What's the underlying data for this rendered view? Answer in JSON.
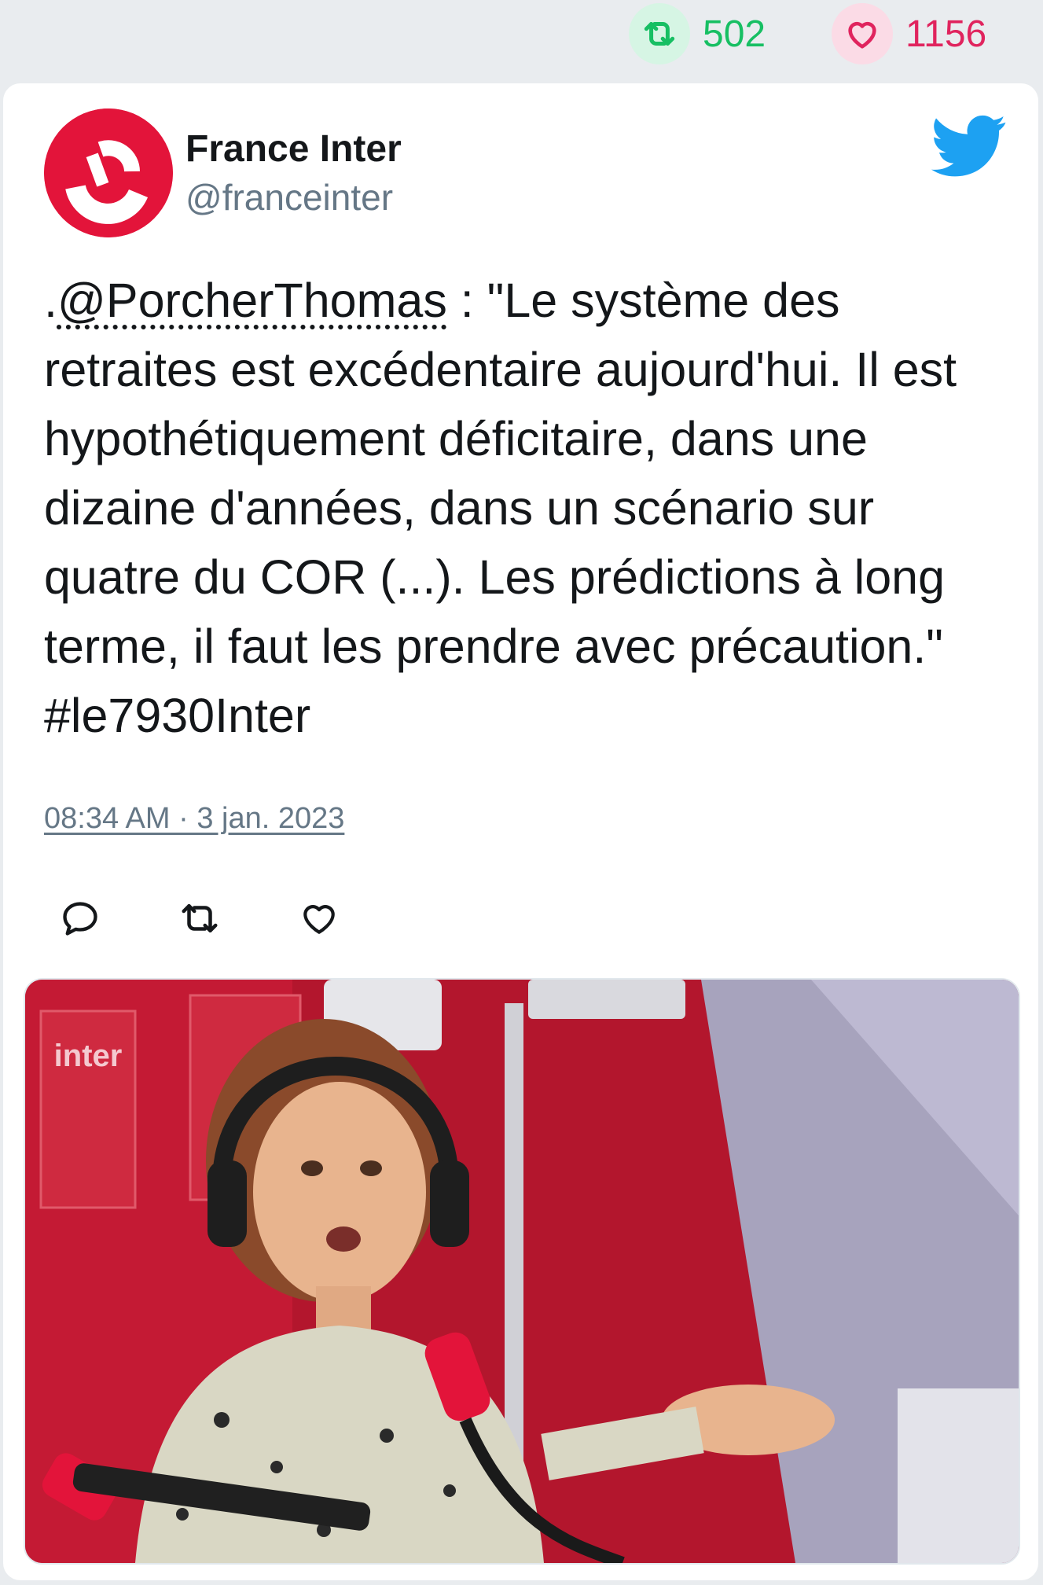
{
  "stats": {
    "retweet_count": "502",
    "like_count": "1156"
  },
  "tweet": {
    "author_name": "France Inter",
    "author_handle": "@franceinter",
    "text_prefix": ".",
    "mention": "@PorcherThomas",
    "text_body": " : \"Le système des retraites est excédentaire aujourd'hui. Il est hypothétiquement déficitaire, dans une dizaine d'années, dans un scénario sur quatre du COR (...). Les prédictions à long terme, il faut les prendre avec précaution.\" #le7930Inter",
    "timestamp": "08:34 AM · 3 jan. 2023",
    "media_overlay_text": "inter"
  },
  "icons": {
    "stat_retweet": "retweet-icon",
    "stat_like": "heart-icon",
    "brand": "twitter-bird-icon",
    "reply": "reply-icon",
    "retweet": "retweet-icon",
    "like": "heart-icon"
  },
  "colors": {
    "retweet_green": "#17bf63",
    "like_red": "#e0245e",
    "twitter_blue": "#1da1f2",
    "handle_gray": "#657786",
    "france_inter_red": "#e3143a"
  }
}
